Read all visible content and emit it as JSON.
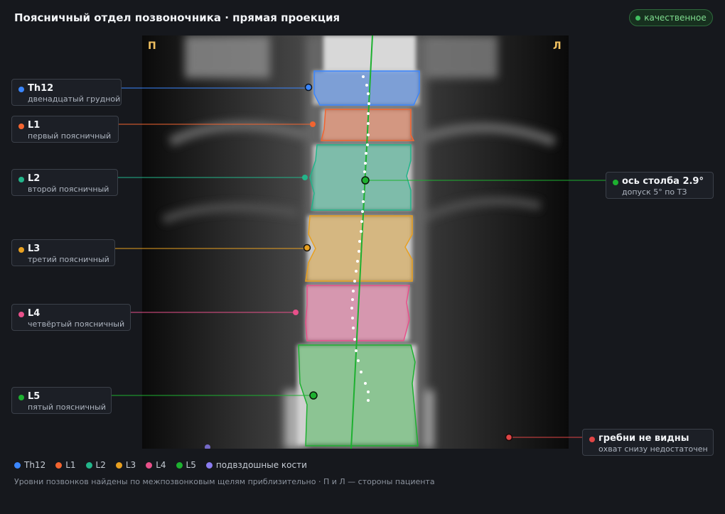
{
  "header": {
    "title": "Поясничный отдел позвоночника · прямая проекция",
    "badge": "качественное",
    "badge_color": "#40c060"
  },
  "image": {
    "right_mark": "П",
    "left_mark": "Л"
  },
  "vertebrae": [
    {
      "id": "Th12",
      "label": "Th12",
      "sublabel": "двенадцатый грудной",
      "color": "#3a86ff"
    },
    {
      "id": "L1",
      "label": "L1",
      "sublabel": "первый поясничный",
      "color": "#f26430"
    },
    {
      "id": "L2",
      "label": "L2",
      "sublabel": "второй поясничный",
      "color": "#22b58a"
    },
    {
      "id": "L3",
      "label": "L3",
      "sublabel": "третий поясничный",
      "color": "#e8a020"
    },
    {
      "id": "L4",
      "label": "L4",
      "sublabel": "четвёртый поясничный",
      "color": "#e8508a"
    },
    {
      "id": "L5",
      "label": "L5",
      "sublabel": "пятый поясничный",
      "color": "#1db030"
    }
  ],
  "axis": {
    "label": "ось столба 2.9°",
    "sublabel": "допуск 5° по ТЗ",
    "color": "#1db030"
  },
  "crests": {
    "label": "гребни не видны",
    "sublabel": "охват снизу недостаточен",
    "color": "#e04545"
  },
  "legend": [
    {
      "label": "Th12",
      "color": "#3a86ff"
    },
    {
      "label": "L1",
      "color": "#f26430"
    },
    {
      "label": "L2",
      "color": "#22b58a"
    },
    {
      "label": "L3",
      "color": "#e8a020"
    },
    {
      "label": "L4",
      "color": "#e8508a"
    },
    {
      "label": "L5",
      "color": "#1db030"
    },
    {
      "label": "подвздошные кости",
      "color": "#8a7cf0"
    }
  ],
  "footnote": "Уровни позвонков найдены по межпозвонковым щелям приблизительно · П и Л — стороны пациента"
}
